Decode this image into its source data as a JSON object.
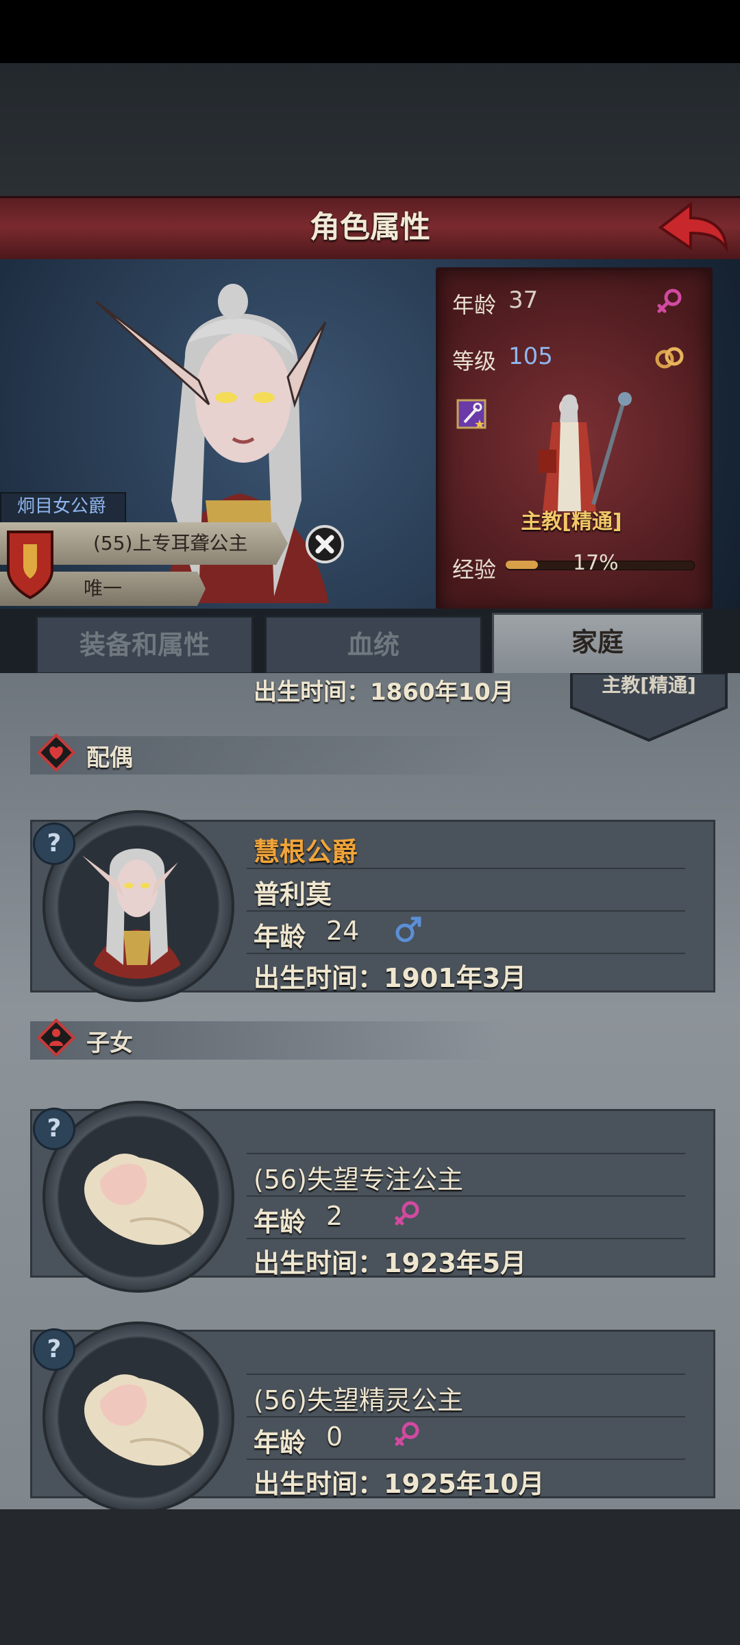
{
  "header": {
    "title": "角色属性"
  },
  "character": {
    "age_label": "年龄",
    "age": "37",
    "level_label": "等级",
    "level": "105",
    "class_name": "主教[精通]",
    "exp_label": "经验",
    "exp_percent_text": "17%",
    "exp_fraction": 0.17,
    "title_badge": "炯目女公爵",
    "name_badge": "(55)上专耳聋公主",
    "unique_badge": "唯一"
  },
  "tabs": [
    {
      "label": "装备和属性"
    },
    {
      "label": "血统"
    },
    {
      "label": "家庭"
    }
  ],
  "previous_entry": {
    "birth": "出生时间：1860年10月",
    "class_name": "主教[精通]"
  },
  "spouse_section": {
    "label": "配偶",
    "spouse": {
      "title": "慧根公爵",
      "name": "普利莫",
      "age_label": "年龄",
      "age": "24",
      "birth": "出生时间：1901年3月"
    }
  },
  "children_section": {
    "label": "子女",
    "children": [
      {
        "name": "(56)失望专注公主",
        "age_label": "年龄",
        "age": "2",
        "birth": "出生时间：1923年5月"
      },
      {
        "name": "(56)失望精灵公主",
        "age_label": "年龄",
        "age": "0",
        "birth": "出生时间：1925年10月"
      }
    ]
  },
  "qmark": "?",
  "colors": {
    "title_bar": "#7a2a2e",
    "gold_text": "#f0a43a",
    "level_blue": "#8fb7ef",
    "female": "#d14aa0",
    "male": "#5b8fd6"
  },
  "icons": [
    "back-arrow-icon",
    "female-icon",
    "rings-icon",
    "skill-staff-icon",
    "close-icon",
    "heart-icon",
    "child-icon",
    "male-icon",
    "question-icon",
    "shield-icon"
  ]
}
